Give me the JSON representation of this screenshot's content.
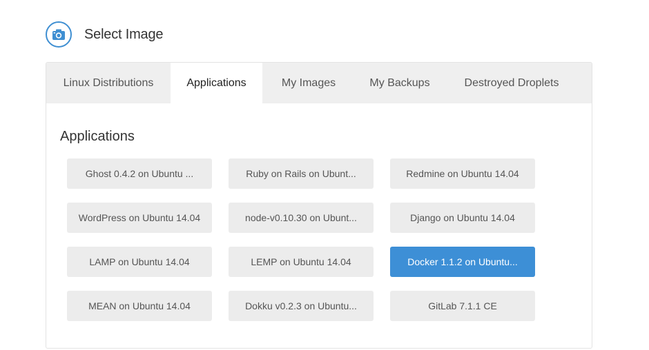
{
  "header": {
    "title": "Select Image",
    "icon": "camera-icon",
    "accent_color": "#3f8fd2"
  },
  "tabs": [
    {
      "label": "Linux Distributions",
      "active": false
    },
    {
      "label": "Applications",
      "active": true
    },
    {
      "label": "My Images",
      "active": false
    },
    {
      "label": "My Backups",
      "active": false
    },
    {
      "label": "Destroyed Droplets",
      "active": false
    }
  ],
  "section": {
    "title": "Applications"
  },
  "apps": [
    {
      "label": "Ghost 0.4.2 on Ubuntu ...",
      "selected": false
    },
    {
      "label": "Ruby on Rails on Ubunt...",
      "selected": false
    },
    {
      "label": "Redmine on Ubuntu 14.04",
      "selected": false
    },
    {
      "label": "WordPress on Ubuntu 14.04",
      "selected": false
    },
    {
      "label": "node-v0.10.30 on Ubunt...",
      "selected": false
    },
    {
      "label": "Django on Ubuntu 14.04",
      "selected": false
    },
    {
      "label": "LAMP on Ubuntu 14.04",
      "selected": false
    },
    {
      "label": "LEMP on Ubuntu 14.04",
      "selected": false
    },
    {
      "label": "Docker 1.1.2 on Ubuntu...",
      "selected": true
    },
    {
      "label": "MEAN on Ubuntu 14.04",
      "selected": false
    },
    {
      "label": "Dokku v0.2.3 on Ubuntu...",
      "selected": false
    },
    {
      "label": "GitLab 7.1.1 CE",
      "selected": false
    }
  ],
  "colors": {
    "selected_bg": "#3d8fd6",
    "button_bg": "#ececec",
    "tab_bar_bg": "#efefef"
  }
}
